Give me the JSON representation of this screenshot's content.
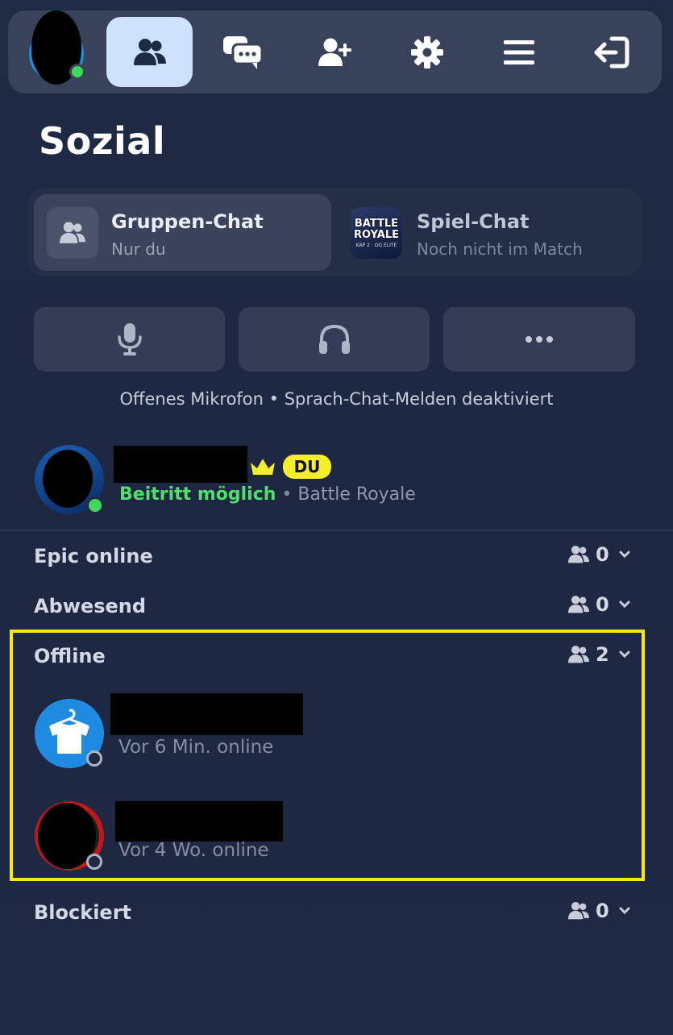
{
  "nav": {
    "items": [
      {
        "name": "friends",
        "icon": "friends-icon",
        "active": true
      },
      {
        "name": "chat",
        "icon": "chat-bubbles-icon",
        "active": false
      },
      {
        "name": "add-friend",
        "icon": "add-friend-icon",
        "active": false
      },
      {
        "name": "settings",
        "icon": "gear-icon",
        "active": false
      },
      {
        "name": "menu",
        "icon": "hamburger-icon",
        "active": false
      },
      {
        "name": "exit",
        "icon": "exit-icon",
        "active": false
      }
    ]
  },
  "page": {
    "title": "Sozial"
  },
  "chat_tabs": {
    "group": {
      "title": "Gruppen-Chat",
      "subtitle": "Nur du"
    },
    "game": {
      "title": "Spiel-Chat",
      "subtitle": "Noch nicht im Match",
      "thumb_line1": "BATTLE",
      "thumb_line2": "ROYALE",
      "thumb_line3": "KAP 2 · OG ELITE"
    }
  },
  "controls": {
    "items": [
      {
        "icon": "microphone-icon"
      },
      {
        "icon": "headphones-icon"
      },
      {
        "icon": "more-icon"
      }
    ],
    "status_text": "Offenes Mikrofon • Sprach-Chat-Melden deaktiviert"
  },
  "self": {
    "badge": "DU",
    "status": "Beitritt möglich",
    "separator": "•",
    "mode": "Battle Royale"
  },
  "sections": {
    "epic_online": {
      "label": "Epic online",
      "count": "0"
    },
    "away": {
      "label": "Abwesend",
      "count": "0"
    },
    "offline": {
      "label": "Offline",
      "count": "2"
    },
    "blocked": {
      "label": "Blockiert",
      "count": "0"
    }
  },
  "offline_friends": [
    {
      "status": "Vor 6 Min. online"
    },
    {
      "status": "Vor 4 Wo. online"
    }
  ],
  "colors": {
    "accent_active": "#cfe2fb",
    "online_green": "#40d85a",
    "highlight_yellow": "#f8e61b",
    "badge_yellow": "#f5ee2a"
  }
}
